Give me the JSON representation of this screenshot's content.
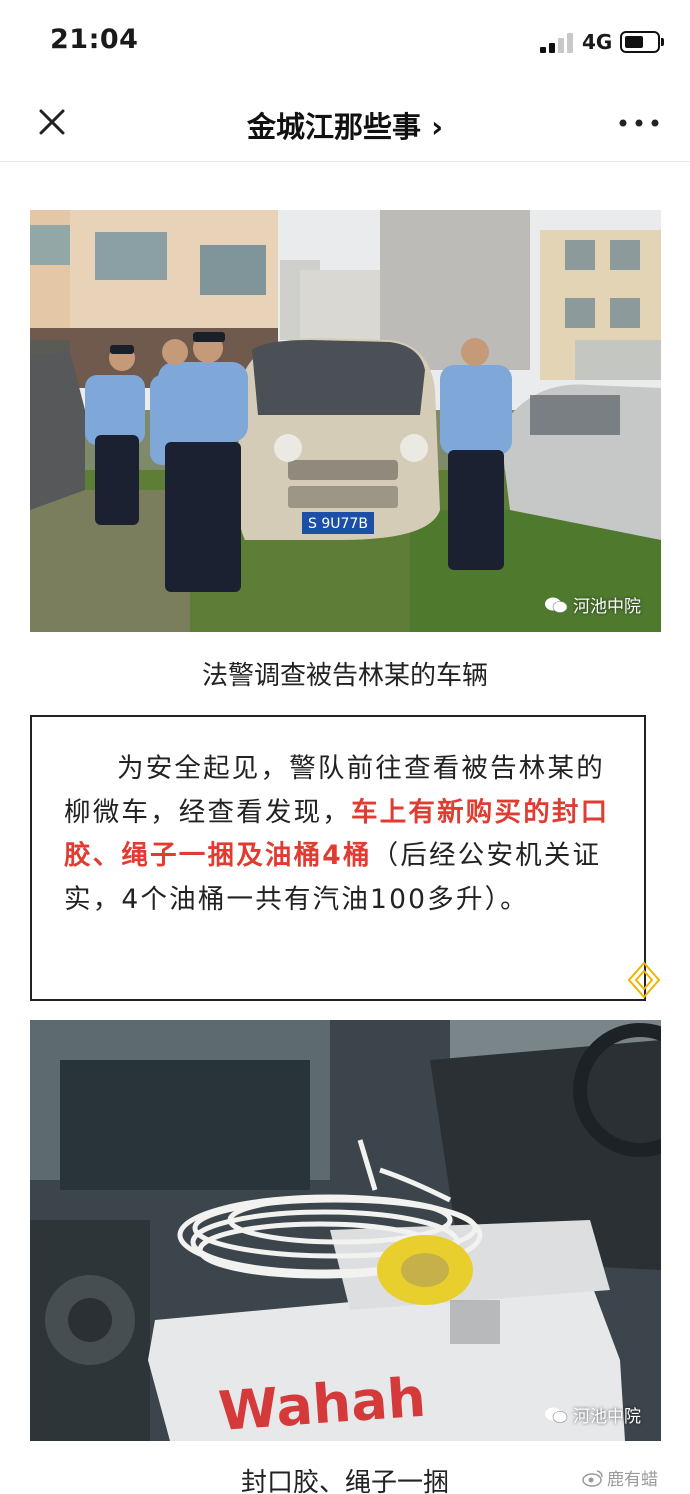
{
  "status_bar": {
    "time": "21:04",
    "network": "4G"
  },
  "nav": {
    "title": "金城江那些事",
    "chevron": "›"
  },
  "photo1": {
    "plate": "S 9U77B",
    "watermark": "河池中院"
  },
  "caption1": "法警调查被告林某的车辆",
  "notice": {
    "text_before": "为安全起见，警队前往查看被告林某的柳微车，经查看发现，",
    "highlight": "车上有新购买的封口胶、绳子一捆及油桶4桶",
    "text_after": "（后经公安机关证实，4个油桶一共有汽油100多升）。"
  },
  "photo2": {
    "box_brand": "Wahah",
    "watermark": "河池中院"
  },
  "caption2": "封口胶、绳子一捆",
  "weibo_watermark": "鹿有蜡",
  "colors": {
    "highlight": "#e03c31",
    "accent_diamond": "#f0b400"
  },
  "icons": [
    "close-icon",
    "chevron-right-icon",
    "more-dots-icon",
    "wechat-icon",
    "diamond-icon",
    "weibo-icon"
  ]
}
